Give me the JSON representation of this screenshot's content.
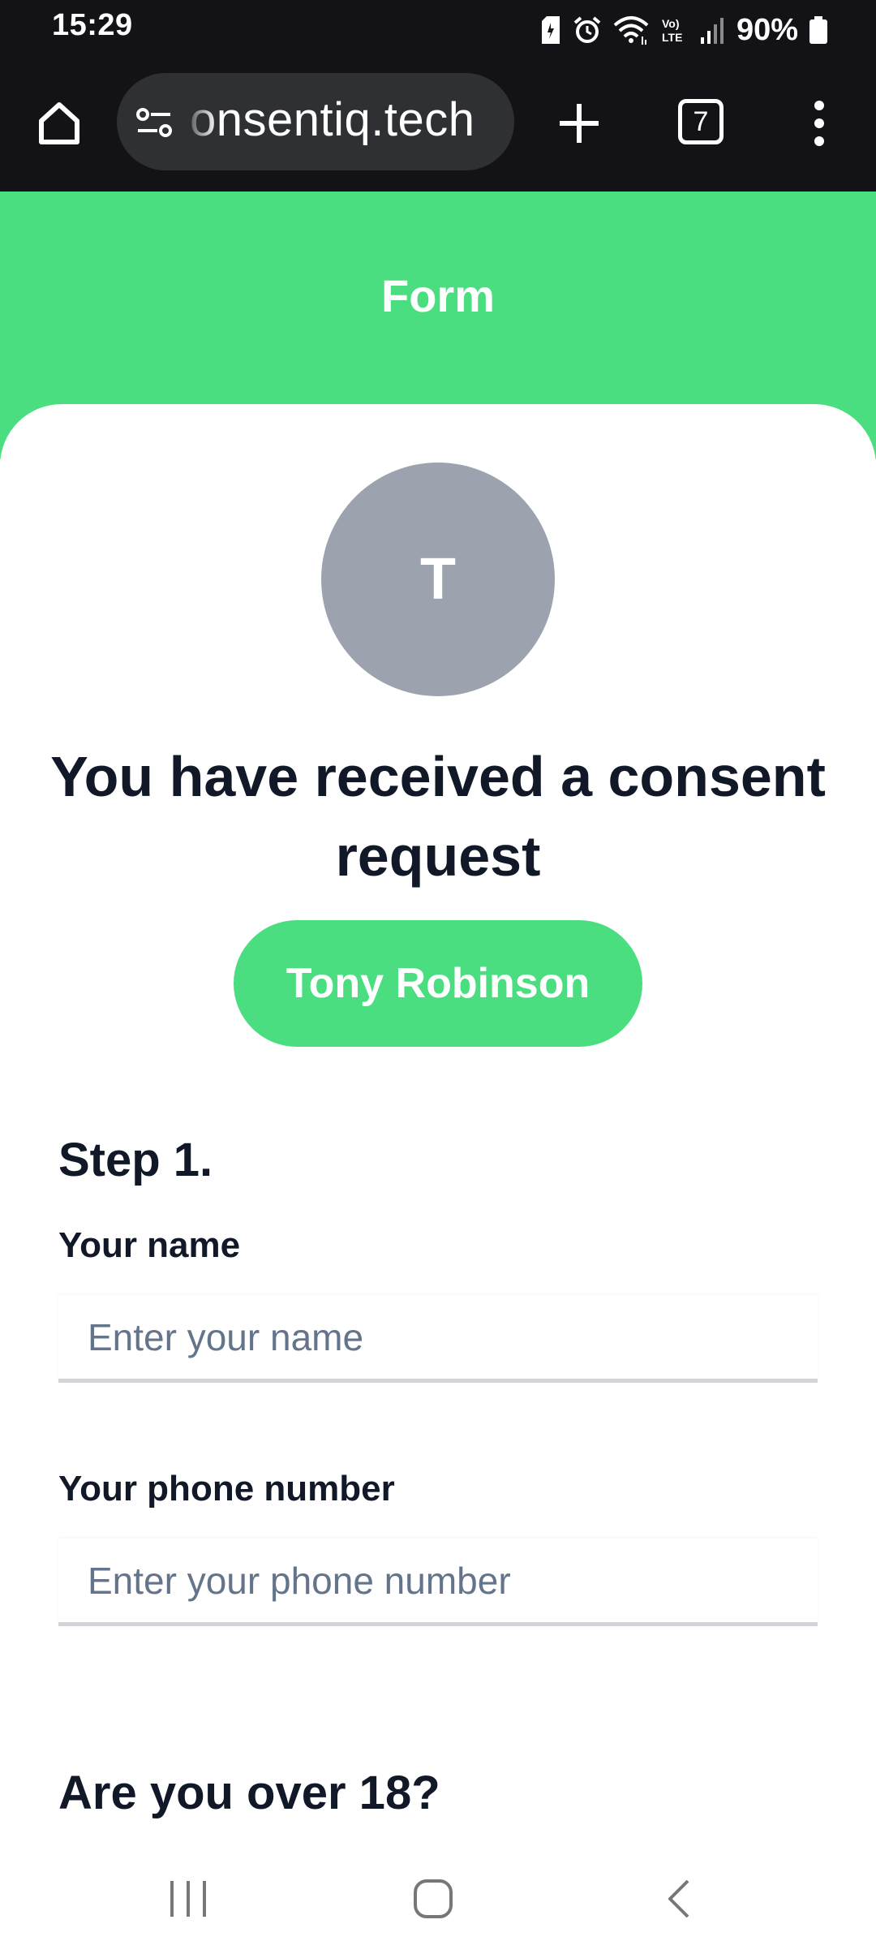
{
  "status_bar": {
    "time": "15:29",
    "battery": "90%",
    "icons": [
      "sim-alert-icon",
      "alarm-icon",
      "wifi-icon",
      "volte-icon",
      "signal-icon",
      "battery-icon"
    ],
    "volte_label": "Vo) LTE"
  },
  "browser": {
    "url": "onsentiq.tech",
    "tab_count": "7",
    "icons": [
      "home-icon",
      "site-info-icon",
      "plus-icon",
      "tabs-icon",
      "more-vert-icon"
    ]
  },
  "header": {
    "title": "Form",
    "color": "#4ade80"
  },
  "card": {
    "avatar_initial": "T",
    "avatar_color": "#9ca3af",
    "heading": "You have received a consent request",
    "sender_name": "Tony Robinson",
    "step_label": "Step 1.",
    "fields": [
      {
        "label": "Your name",
        "placeholder": "Enter your name",
        "value": ""
      },
      {
        "label": "Your phone number",
        "placeholder": "Enter your phone number",
        "value": ""
      }
    ],
    "age_question": "Are you over 18?"
  },
  "nav_bar": {
    "icons": [
      "recents-icon",
      "home-nav-icon",
      "back-icon"
    ]
  }
}
